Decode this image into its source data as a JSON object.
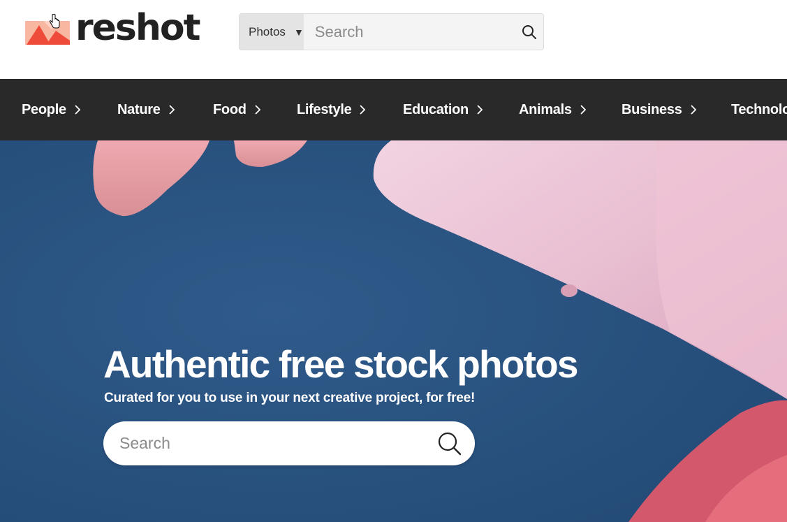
{
  "brand": {
    "name": "reshot",
    "logo_colors": [
      "#f7b7a0",
      "#ef4b3a",
      "#ffd2c4"
    ]
  },
  "header_search": {
    "type_selected": "Photos",
    "placeholder": "Search",
    "icon": "search-icon"
  },
  "nav": {
    "items": [
      {
        "label": "People"
      },
      {
        "label": "Nature"
      },
      {
        "label": "Food"
      },
      {
        "label": "Lifestyle"
      },
      {
        "label": "Education"
      },
      {
        "label": "Animals"
      },
      {
        "label": "Business"
      },
      {
        "label": "Technolo"
      }
    ],
    "chevron_icon": "chevron-right-icon"
  },
  "hero": {
    "title": "Authentic free stock photos",
    "subtitle": "Curated for you to use in your next creative project, for free!",
    "search_placeholder": "Search",
    "background_color": "#2c5282"
  },
  "colors": {
    "nav_bg": "#292929",
    "text_dark": "#222222"
  }
}
